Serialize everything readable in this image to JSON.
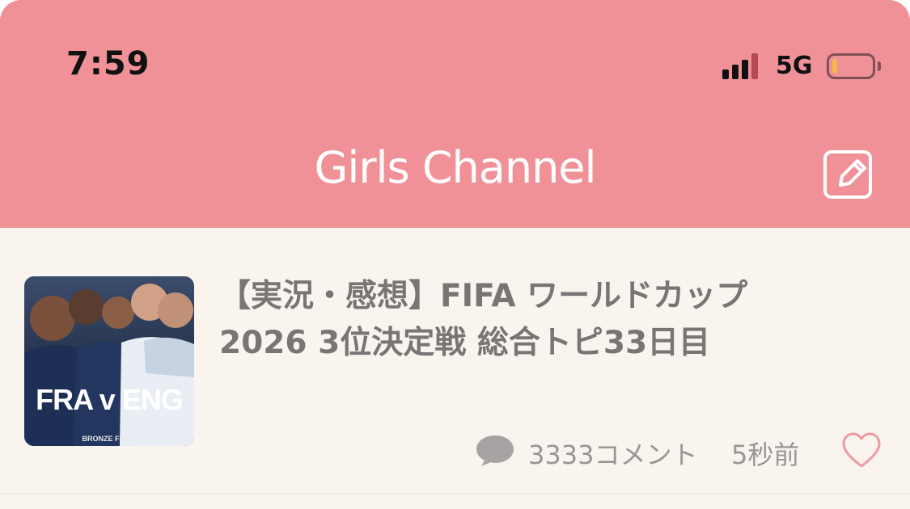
{
  "status_bar": {
    "time": "7:59",
    "network": "5G",
    "battery_level": 0.12,
    "battery_color": "#f4c531"
  },
  "header": {
    "brand": "Girls Channel",
    "compose_icon": "compose-icon",
    "background": "#f09198"
  },
  "topic": {
    "thumbnail": {
      "headline": "FRA v ENG",
      "caption": "BRONZE FINAL"
    },
    "title": "【実況・感想】FIFA ワールドカップ 2026 3位決定戦 総合トピ33日目",
    "comments": "3333コメント",
    "time_ago": "5秒前",
    "comment_icon": "comment-bubble-icon",
    "like_icon": "heart-icon"
  }
}
